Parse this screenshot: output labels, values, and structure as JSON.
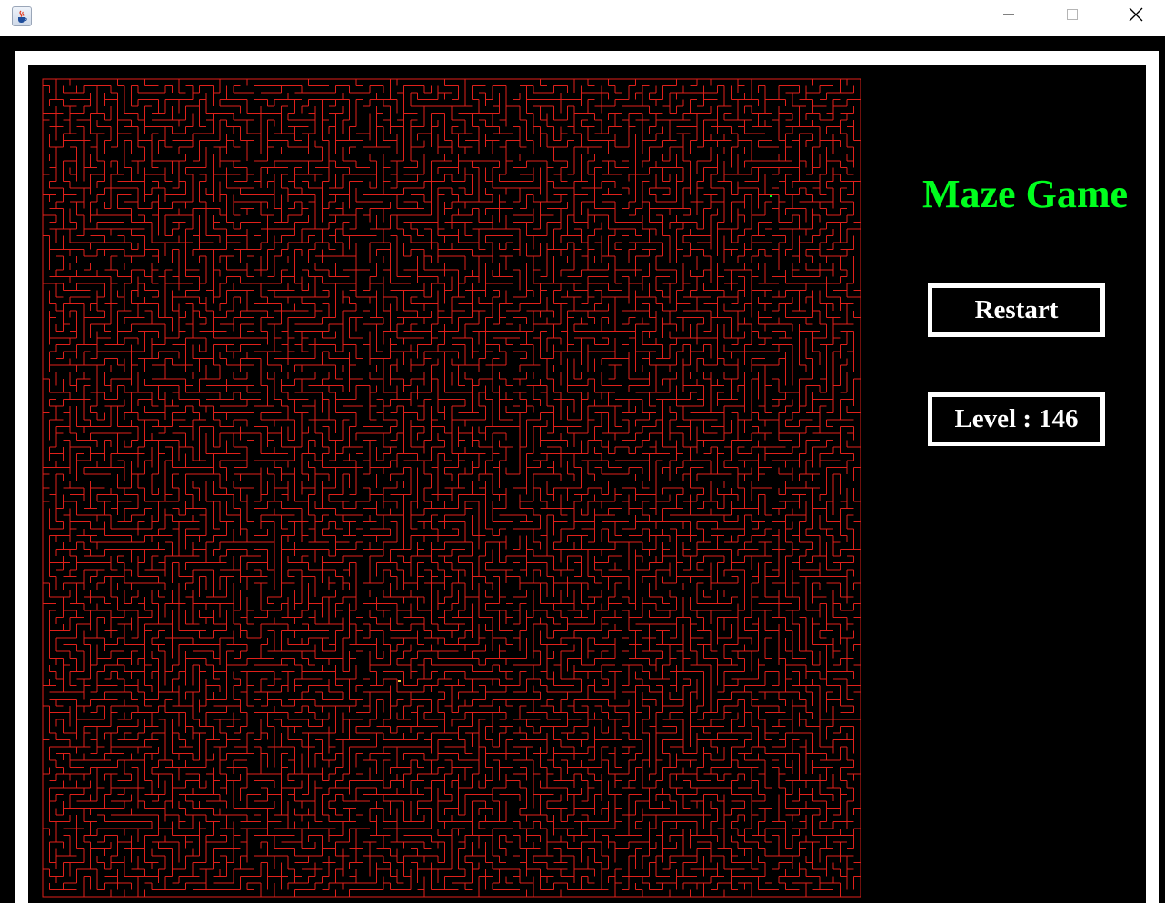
{
  "window": {
    "icon": "java-cup-icon",
    "controls": [
      "minimize-icon",
      "maximize-icon",
      "close-icon"
    ]
  },
  "game": {
    "title": "Maze Game",
    "restart_label": "Restart",
    "level_label": "Level :",
    "level_value": "146",
    "colors": {
      "background": "#000000",
      "maze_wall": "#e0201a",
      "title": "#00ff1e",
      "panel_text": "#ffffff",
      "player": "#f5d442",
      "goal": "#00ff1e"
    },
    "maze": {
      "columns": 120,
      "rows": 120,
      "seed": 146
    }
  }
}
